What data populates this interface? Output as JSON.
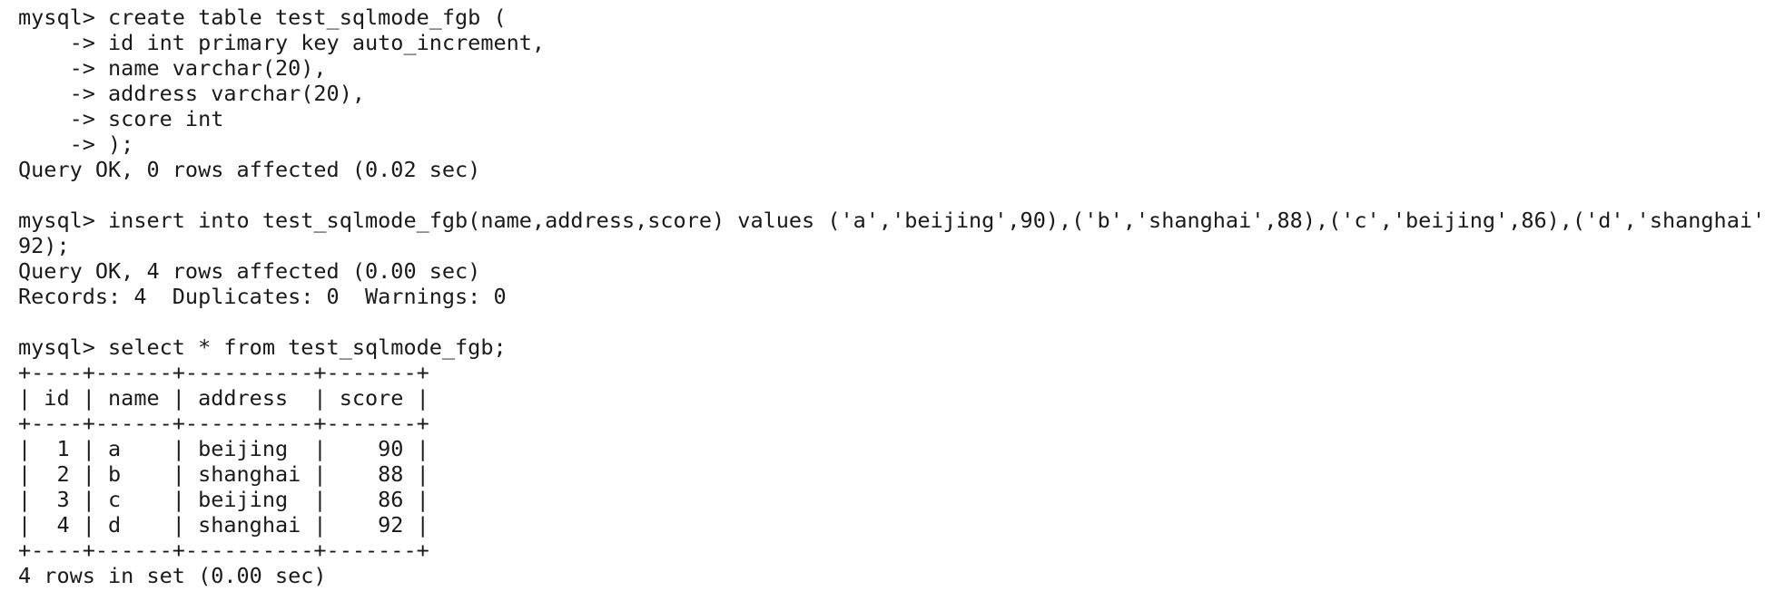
{
  "terminal": {
    "lines": [
      "mysql> create table test_sqlmode_fgb (",
      "    -> id int primary key auto_increment,",
      "    -> name varchar(20),",
      "    -> address varchar(20),",
      "    -> score int",
      "    -> );",
      "Query OK, 0 rows affected (0.02 sec)",
      "",
      "mysql> insert into test_sqlmode_fgb(name,address,score) values ('a','beijing',90),('b','shanghai',88),('c','beijing',86),('d','shanghai',",
      "92);",
      "Query OK, 4 rows affected (0.00 sec)",
      "Records: 4  Duplicates: 0  Warnings: 0",
      "",
      "mysql> select * from test_sqlmode_fgb;",
      "+----+------+----------+-------+",
      "| id | name | address  | score |",
      "+----+------+----------+-------+",
      "|  1 | a    | beijing  |    90 |",
      "|  2 | b    | shanghai |    88 |",
      "|  3 | c    | beijing  |    86 |",
      "|  4 | d    | shanghai |    92 |",
      "+----+------+----------+-------+",
      "4 rows in set (0.00 sec)"
    ]
  }
}
